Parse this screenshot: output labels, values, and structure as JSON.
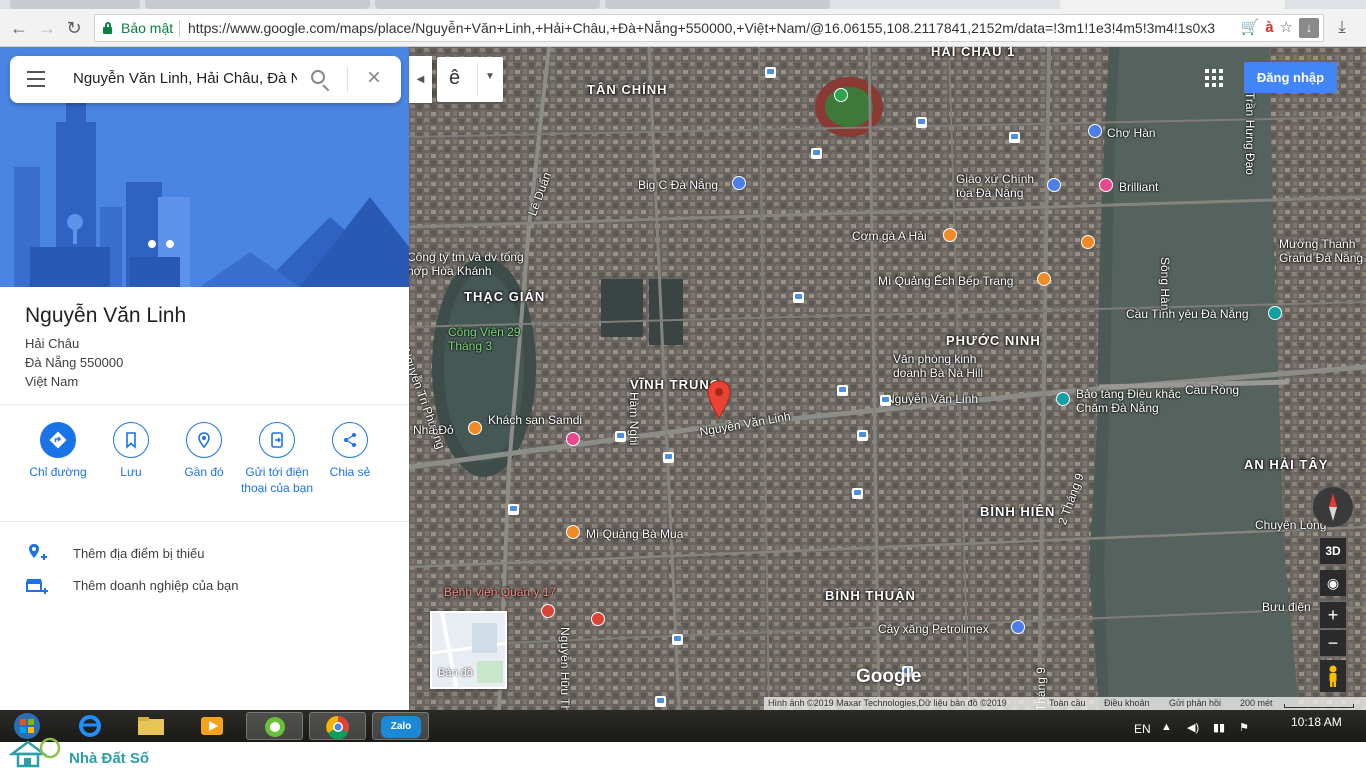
{
  "browser": {
    "secure_label": "Bảo mật",
    "url": "https://www.google.com/maps/place/Nguyễn+Văn+Linh,+Hải+Châu,+Đà+Nẵng+550000,+Việt+Nam/@16.06155,108.2117841,2152m/data=!3m1!1e3!4m5!3m4!1s0x3"
  },
  "search": {
    "value": "Nguyễn Văn Linh, Hải Châu, Đà Nẵng"
  },
  "place": {
    "title": "Nguyễn Văn Linh",
    "address_lines": [
      "Hải Châu",
      "Đà Nẵng 550000",
      "Việt Nam"
    ]
  },
  "actions": [
    {
      "label": "Chỉ đường",
      "icon": "directions-icon"
    },
    {
      "label": "Lưu",
      "icon": "bookmark-icon"
    },
    {
      "label": "Gần đó",
      "icon": "nearby-icon"
    },
    {
      "label": "Gửi tới điện thoại của bạn",
      "icon": "send-to-phone-icon"
    },
    {
      "label": "Chia sẻ",
      "icon": "share-icon"
    }
  ],
  "extras": [
    {
      "label": "Thêm địa điểm bị thiếu",
      "icon": "add-place-icon"
    },
    {
      "label": "Thêm doanh nghiệp của bạn",
      "icon": "add-business-icon"
    }
  ],
  "map": {
    "lang_char": "ê",
    "signin_label": "Đăng nhập",
    "minimap_label": "Bản đồ",
    "logo": "Google",
    "btn_3d": "3D",
    "zoom_in": "+",
    "zoom_out": "−",
    "districts": [
      "HẢI CHÂU 1",
      "TÂN CHÍNH",
      "THẠC GIÁN",
      "VĨNH TRUNG",
      "PHƯỚC NINH",
      "BÌNH HIÊN",
      "BÌNH THUẬN",
      "AN HẢI TÂY"
    ],
    "labels": [
      "Lê Duẩn",
      "Big C Đà Nẵng",
      "Chợ Hàn",
      "Giáo xứ Chính tòa Đà Nẵng",
      "Brilliant",
      "Cơm gà A Hải",
      "Mì Quảng Ếch Bếp Trang",
      "Sông Hàn",
      "Cầu Tình yêu Đà Nẵng",
      "Mường Thanh Grand Đà Nẵng",
      "Công ty tm và dv tổng hợp Hòa Khánh",
      "Công Viên 29 Tháng 3",
      "Văn phòng kinh doanh Bà Nà Hill",
      "Bảo tàng Điêu khắc Chăm Đà Nẵng",
      "Cầu Rồng",
      "Khách sạn Samdi",
      "Nguyễn Văn Linh",
      "Mì Quảng Bà Mua",
      "Bệnh viện Quân y 17",
      "Cây xăng Petrolimex",
      "Bưu điện",
      "Chuyện Lòng",
      "2 Tháng 9",
      "Nguyễn Tri Phương",
      "Hàm Nghi",
      "Nguyễn Hữu Thọ",
      "Trần Hưng Đạo",
      "Nhà Đỏ"
    ],
    "attribution": [
      "Hình ảnh ©2019 Maxar Technologies,Dữ liệu bản đồ ©2019",
      "Toàn cầu",
      "Điều khoản",
      "Gửi phản hồi",
      "200 mét"
    ]
  },
  "taskbar": {
    "zalo": "Zalo",
    "lang": "EN",
    "time": "10:18 AM"
  },
  "watermark": {
    "brand": "Nhà Đất Số"
  },
  "colors": {
    "accent": "#1a73e8",
    "secure_green": "#0b8043",
    "signin_blue": "#4285f4"
  }
}
